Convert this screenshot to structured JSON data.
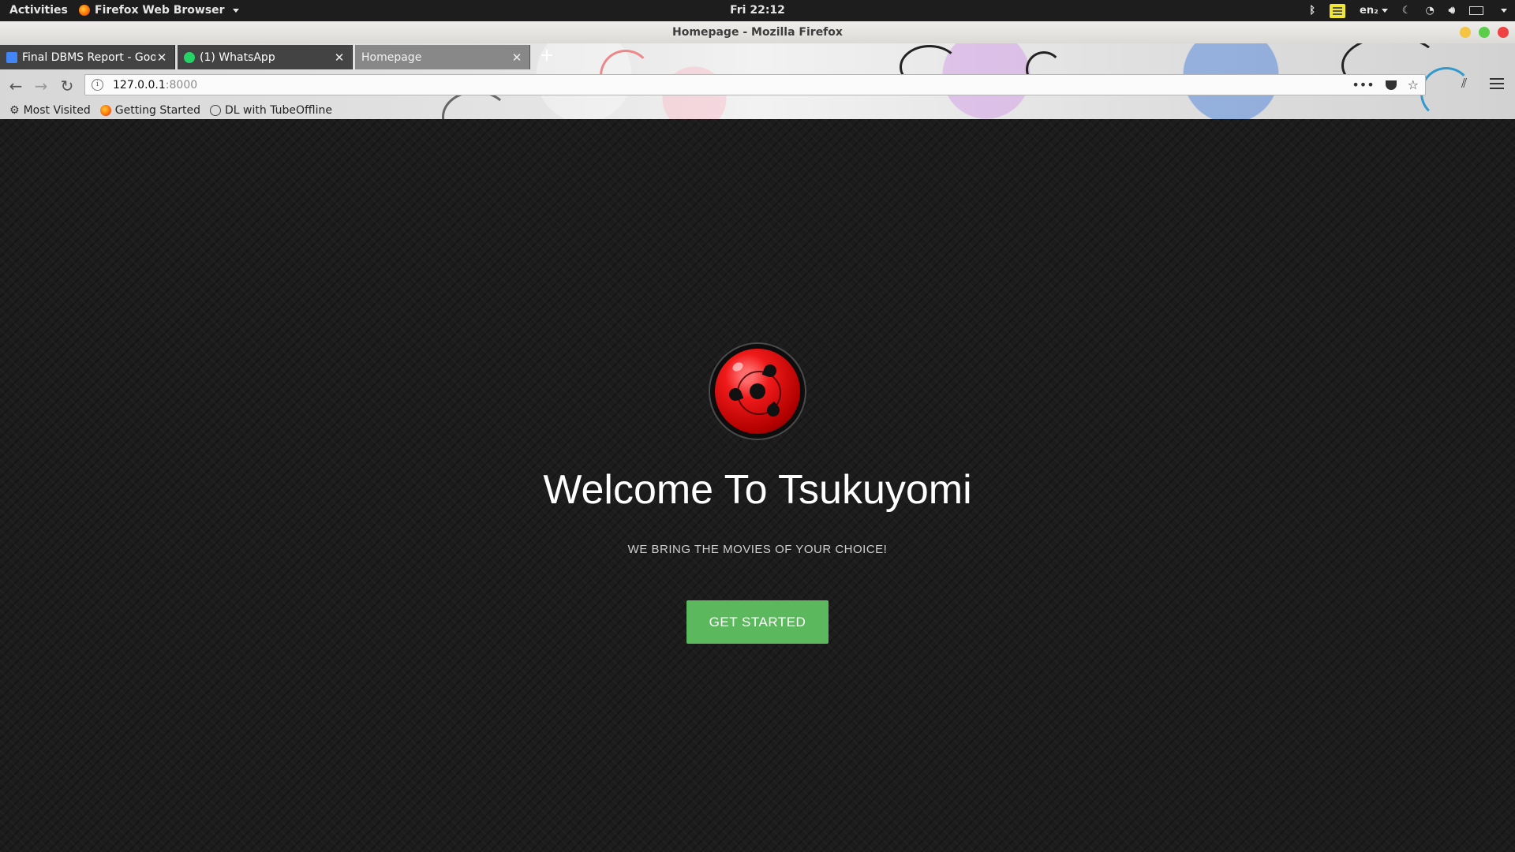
{
  "topbar": {
    "activities": "Activities",
    "app_name": "Firefox Web Browser",
    "clock": "Fri 22:12",
    "input_method": "en₂"
  },
  "window": {
    "title": "Homepage - Mozilla Firefox"
  },
  "tabs": [
    {
      "label": "Final DBMS Report - Goo",
      "favicon": "docs-icon",
      "color": "#4285f4"
    },
    {
      "label": "(1) WhatsApp",
      "favicon": "whatsapp-icon",
      "color": "#25d366"
    },
    {
      "label": "Homepage",
      "favicon": "",
      "active": true
    }
  ],
  "urlbar": {
    "host": "127.0.0.1",
    "port": ":8000"
  },
  "bookmarks": [
    {
      "label": "Most Visited",
      "icon": "gear-icon"
    },
    {
      "label": "Getting Started",
      "icon": "firefox-icon"
    },
    {
      "label": "DL with TubeOffline",
      "icon": "globe-icon"
    }
  ],
  "page": {
    "headline": "Welcome To Tsukuyomi",
    "tagline": "WE BRING THE MOVIES OF YOUR CHOICE!",
    "cta_label": "GET STARTED",
    "cta_color": "#5cb85c",
    "logo": "sharingan-logo"
  }
}
